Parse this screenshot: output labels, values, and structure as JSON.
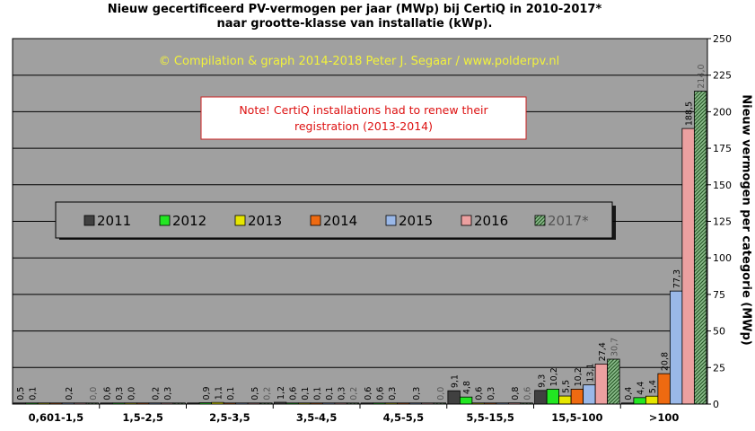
{
  "chart_data": {
    "type": "bar",
    "title": "Nieuw  gecertificeerd  PV-vermogen  per jaar  (MWp)  bij  CertiQ  in  2010-2017*",
    "subtitle": "naar  grootte-klasse  van  installatie  (kWp).",
    "copyright": "© Compilation  & graph 2014-2018 Peter J. Segaar / www.polderpv.nl",
    "note_line1": "Note! CertiQ installations   had to renew  their",
    "note_line2": "registration  (2013-2014)",
    "ylabel": "Nieuw  vermogen  per categorie  (MWp)",
    "xlabel": "",
    "ylim": [
      0,
      250
    ],
    "yticks": [
      0,
      25,
      50,
      75,
      100,
      125,
      150,
      175,
      200,
      225,
      250
    ],
    "grid": true,
    "legend_position": "center-left",
    "categories": [
      "0,601-1,5",
      "1,5-2,5",
      "2,5-3,5",
      "3,5-4,5",
      "4,5-5,5",
      "5,5-15,5",
      "15,5-100",
      ">100"
    ],
    "series": [
      {
        "name": "2011",
        "color": "#404040",
        "values": [
          0.5,
          0.6,
          0.0,
          1.2,
          0.6,
          9.1,
          9.3,
          0.4
        ],
        "labels": [
          "0,5",
          "0,6",
          "",
          "1,2",
          "0,6",
          "9,1",
          "9,3",
          "0,4"
        ]
      },
      {
        "name": "2012",
        "color": "#22e622",
        "values": [
          0.1,
          0.3,
          0.9,
          0.6,
          0.6,
          4.8,
          10.2,
          4.4
        ],
        "labels": [
          "0,1",
          "0,3",
          "0,9",
          "0,6",
          "0,6",
          "4,8",
          "10,2",
          "4,4"
        ]
      },
      {
        "name": "2013",
        "color": "#e6e600",
        "values": [
          0.0,
          0.0,
          1.1,
          0.1,
          0.3,
          0.6,
          5.5,
          5.4
        ],
        "labels": [
          "",
          "0,0",
          "1,1",
          "0,1",
          "0,3",
          "0,6",
          "5,5",
          "5,4"
        ]
      },
      {
        "name": "2014",
        "color": "#ee6a11",
        "values": [
          0.0,
          0.0,
          0.1,
          0.1,
          0.0,
          0.3,
          10.2,
          20.8
        ],
        "labels": [
          "",
          "",
          "0,1",
          "0,1",
          "",
          "0,3",
          "10,2",
          "20,8"
        ]
      },
      {
        "name": "2015",
        "color": "#9ab8e8",
        "values": [
          0.2,
          0.2,
          0.0,
          0.1,
          0.3,
          0.0,
          13.1,
          77.3
        ],
        "labels": [
          "0,2",
          "0,2",
          "",
          "0,1",
          "0,3",
          "",
          "13,1",
          "77,3"
        ]
      },
      {
        "name": "2016",
        "color": "#eca0a0",
        "values": [
          0.0,
          0.3,
          0.5,
          0.3,
          0.0,
          0.8,
          27.4,
          188.5
        ],
        "labels": [
          "",
          "0,3",
          "0,5",
          "0,3",
          "",
          "0,8",
          "27,4",
          "188,5"
        ]
      },
      {
        "name": "2017*",
        "color": "#4a7a4a",
        "hatched": true,
        "values": [
          0.0,
          0.0,
          0.2,
          0.2,
          0.0,
          0.6,
          30.7,
          214.0
        ],
        "labels": [
          "0,0",
          "",
          "0,2",
          "0,2",
          "0,0",
          "0,6",
          "30,7",
          "214,0"
        ]
      }
    ]
  }
}
